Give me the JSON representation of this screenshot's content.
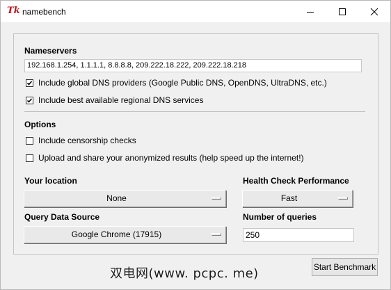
{
  "window": {
    "title": "namebench",
    "icon": "tk-feather-icon",
    "icon_glyph": "Tk",
    "controls": [
      "minimize",
      "maximize",
      "close"
    ]
  },
  "nameservers": {
    "heading": "Nameservers",
    "value": "192.168.1.254, 1.1.1.1, 8.8.8.8, 209.222.18.222, 209.222.18.218",
    "options": [
      {
        "label": "Include global DNS providers (Google Public DNS, OpenDNS, UltraDNS, etc.)",
        "checked": true
      },
      {
        "label": "Include best available regional DNS services",
        "checked": true
      }
    ]
  },
  "options": {
    "heading": "Options",
    "items": [
      {
        "label": "Include censorship checks",
        "checked": false
      },
      {
        "label": "Upload and share your anonymized results (help speed up the internet!)",
        "checked": false
      }
    ]
  },
  "location": {
    "label": "Your location",
    "value": "None"
  },
  "health_check": {
    "label": "Health Check Performance",
    "value": "Fast"
  },
  "query_source": {
    "label": "Query Data Source",
    "value": "Google Chrome (17915)"
  },
  "num_queries": {
    "label": "Number of queries",
    "value": "250"
  },
  "start_button": {
    "label": "Start Benchmark"
  },
  "watermark": {
    "text": "双电网(www. pcpc. me)"
  },
  "colors": {
    "window_bg": "#f0f0f0",
    "titlebar_bg": "#ffffff",
    "icon_red": "#c0141c"
  }
}
